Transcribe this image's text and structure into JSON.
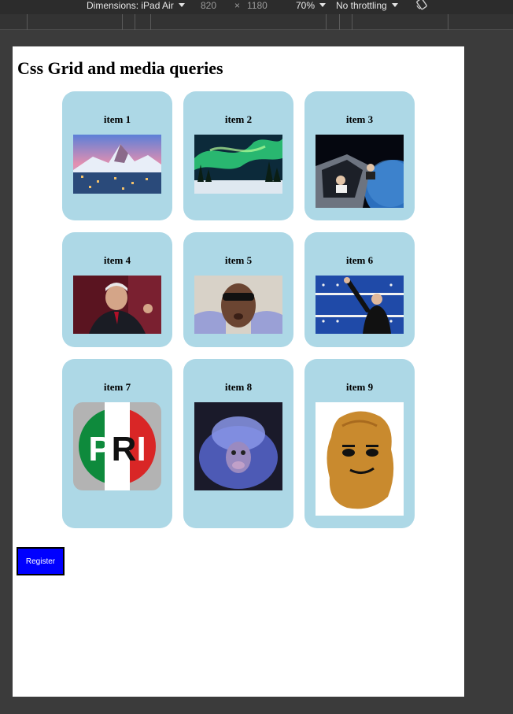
{
  "devtools": {
    "dimensions_label": "Dimensions: iPad Air",
    "width": "820",
    "times": "×",
    "height": "1180",
    "zoom": "70%",
    "throttling": "No throttling",
    "rotate_icon": "rotate-icon"
  },
  "page": {
    "title": "Css Grid and media queries",
    "register_label": "Register"
  },
  "items": [
    {
      "label": "item 1",
      "image": "snowy-mountain-village"
    },
    {
      "label": "item 2",
      "image": "northern-lights"
    },
    {
      "label": "item 3",
      "image": "car-in-space"
    },
    {
      "label": "item 4",
      "image": "man-at-podium"
    },
    {
      "label": "item 5",
      "image": "man-with-sunglasses"
    },
    {
      "label": "item 6",
      "image": "man-waving-at-podium"
    },
    {
      "label": "item 7",
      "image": "pri-logo"
    },
    {
      "label": "item 8",
      "image": "blurry-monkey"
    },
    {
      "label": "item 9",
      "image": "nugget-face"
    }
  ],
  "logo_text": "PRI"
}
